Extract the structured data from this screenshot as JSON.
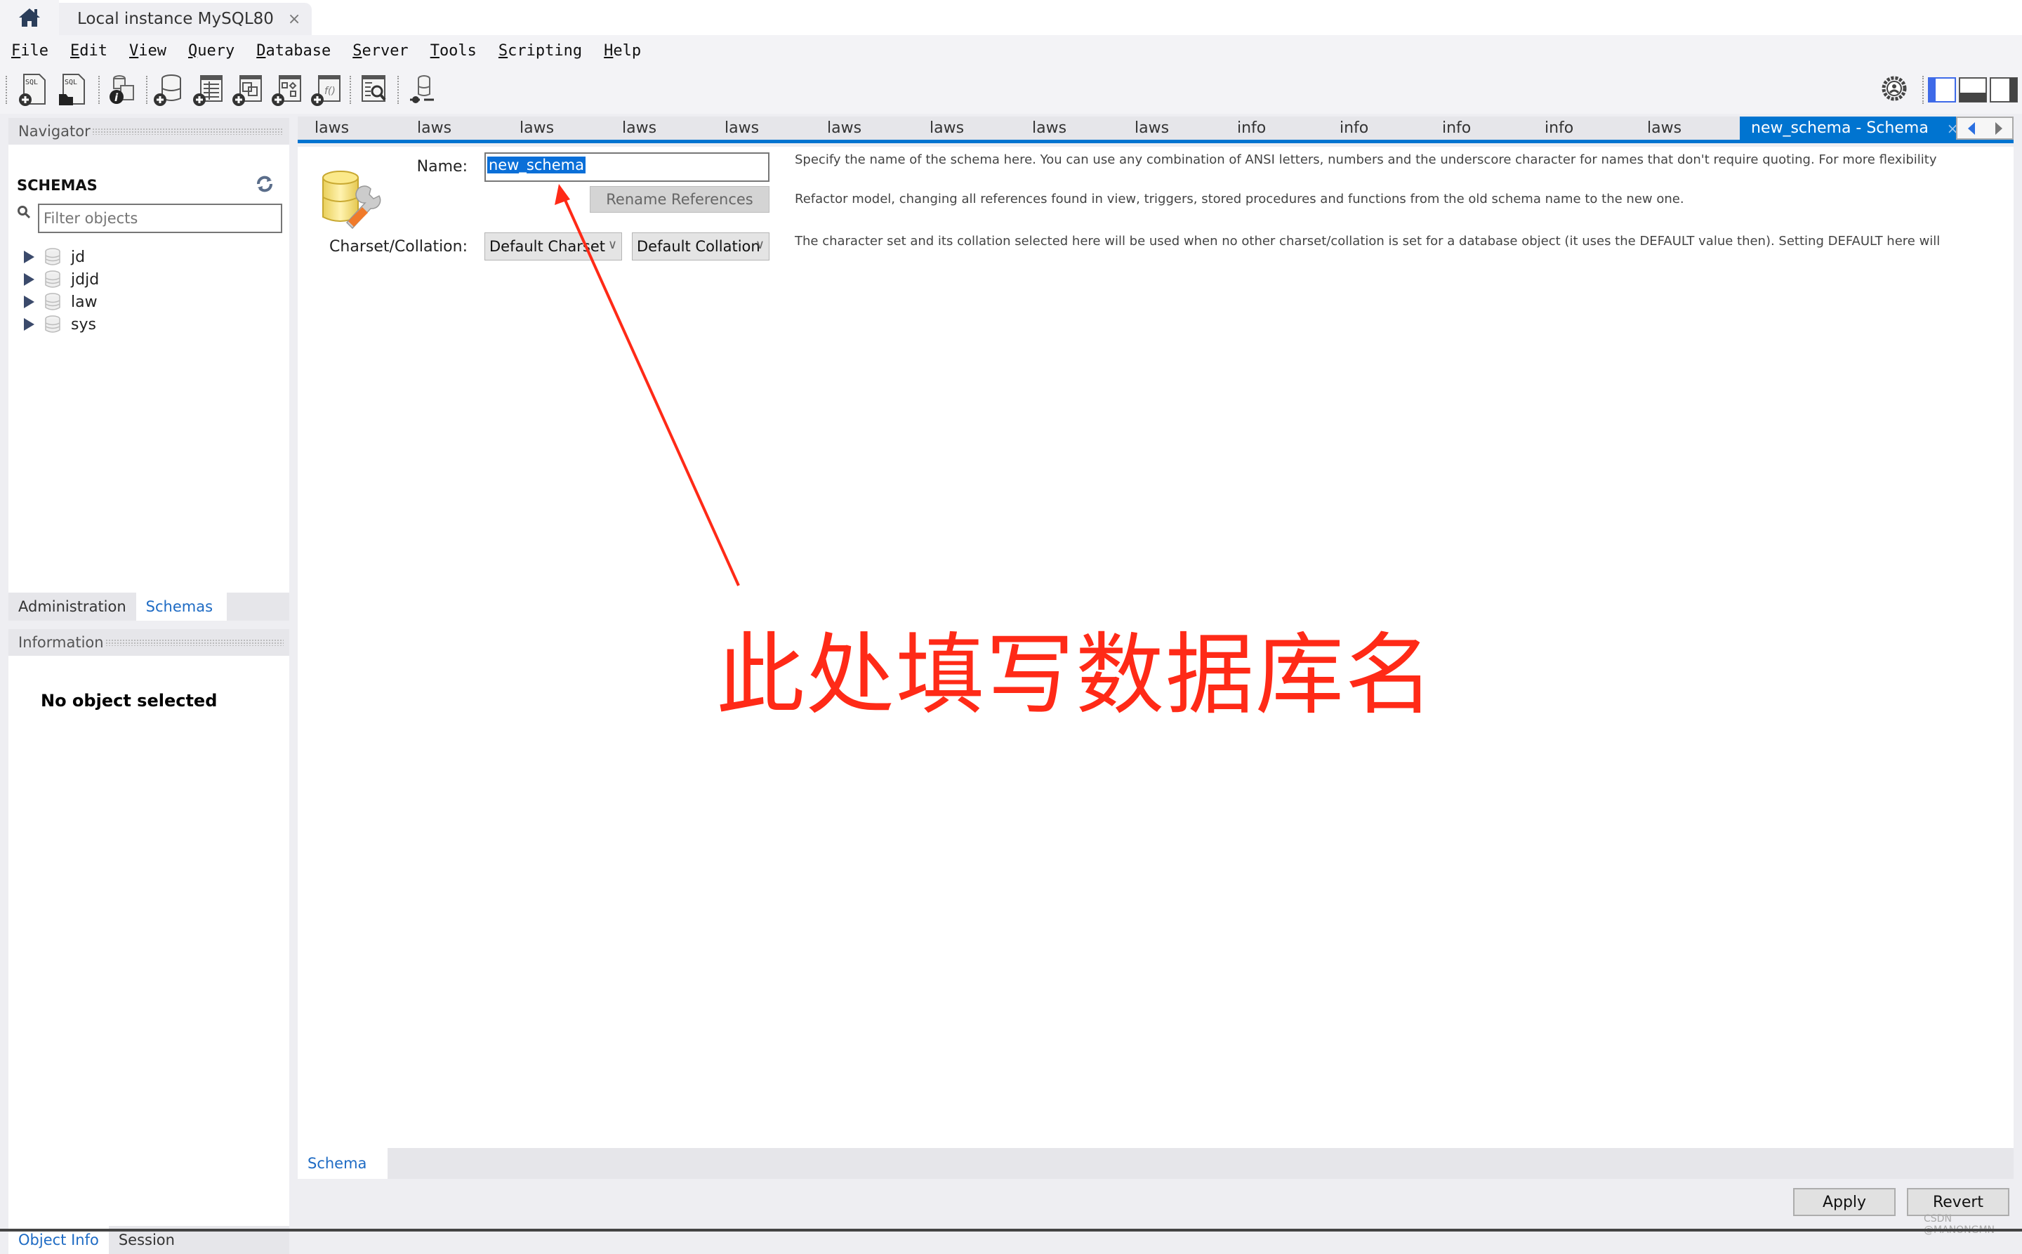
{
  "window": {
    "home_icon": "home-icon",
    "connection_tab": "Local instance MySQL80",
    "close_glyph": "×"
  },
  "menu": [
    "File",
    "Edit",
    "View",
    "Query",
    "Database",
    "Server",
    "Tools",
    "Scripting",
    "Help"
  ],
  "toolbar": {
    "icons": [
      "new-sql-tab-icon",
      "open-sql-script-icon",
      "schema-inspector-icon",
      "create-schema-icon",
      "create-table-icon",
      "create-view-icon",
      "create-procedure-icon",
      "create-function-icon",
      "search-table-data-icon",
      "reconnect-icon"
    ],
    "right_icons": [
      "preferences-gear-icon",
      "toggle-sidebar-icon",
      "toggle-output-icon",
      "toggle-secondary-sidebar-icon"
    ]
  },
  "navigator": {
    "title": "Navigator",
    "schemas_title": "SCHEMAS",
    "filter_placeholder": "Filter objects",
    "schemas": [
      "jd",
      "jdjd",
      "law",
      "sys"
    ],
    "tabs": [
      "Administration",
      "Schemas"
    ],
    "active_tab": "Schemas"
  },
  "information": {
    "title": "Information",
    "message": "No object selected",
    "tabs": [
      "Object Info",
      "Session"
    ],
    "active_tab": "Object Info"
  },
  "editor_tabs": [
    "laws",
    "laws",
    "laws",
    "laws",
    "laws",
    "laws",
    "laws",
    "laws",
    "laws",
    "info",
    "info",
    "info",
    "info",
    "laws"
  ],
  "active_editor_tab": "new_schema - Schema",
  "schema_editor": {
    "name_label": "Name:",
    "name_value": "new_schema",
    "rename_button": "Rename References",
    "charset_label": "Charset/Collation:",
    "charset_value": "Default Charset",
    "collation_value": "Default Collation",
    "help_name": "Specify the name of the schema here. You can use any combination of ANSI letters, numbers and the underscore character for names that don't require quoting. For more flexibility",
    "help_rename": "Refactor model, changing all references found in view, triggers, stored procedures and functions from the old schema name to the new one.",
    "help_charset": "The character set and its collation selected here will be used when no other charset/collation is set for a database object (it uses the DEFAULT value then). Setting DEFAULT here will",
    "bottom_tab": "Schema"
  },
  "actions": {
    "apply": "Apply",
    "revert": "Revert"
  },
  "annotation": {
    "text": "此处填写数据库名",
    "color": "#ff2a17"
  },
  "watermark": "CSDN @MANONGMN",
  "colors": {
    "accent": "#0074d0",
    "link": "#1e6bc4",
    "selection": "#0a6fd8"
  }
}
